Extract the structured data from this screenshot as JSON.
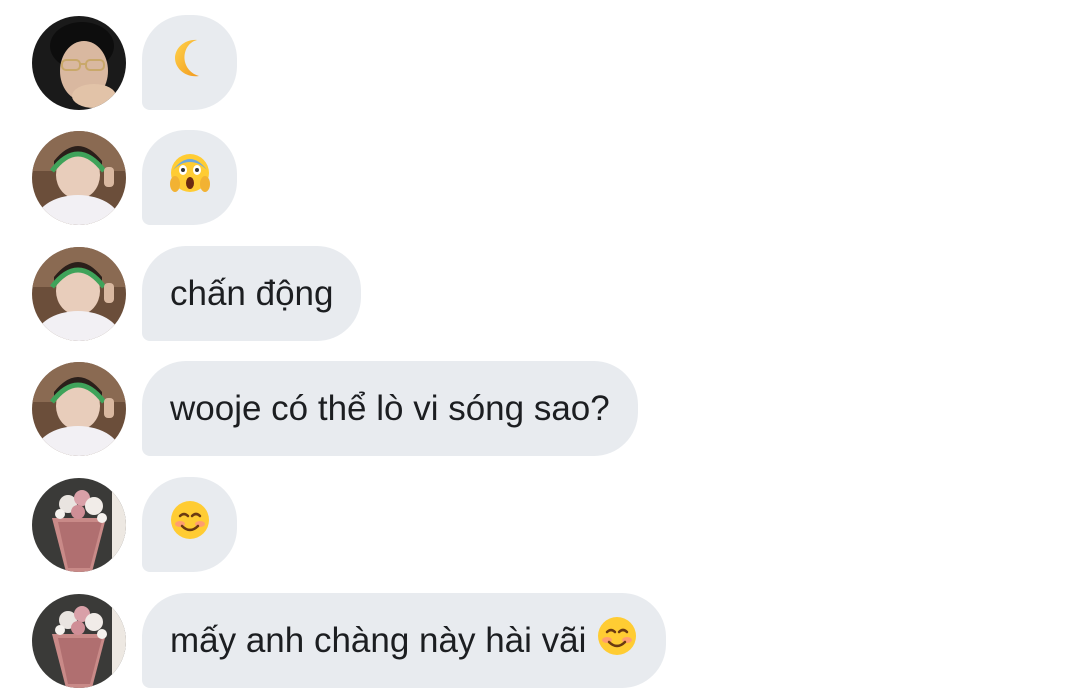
{
  "messages": [
    {
      "avatar": "glasses-man-avatar",
      "text": "",
      "emoji": "crescent-moon-icon"
    },
    {
      "avatar": "headphones-boy-avatar",
      "text": "",
      "emoji": "screaming-face-icon"
    },
    {
      "avatar": "headphones-boy-avatar",
      "text": "chấn động",
      "emoji": ""
    },
    {
      "avatar": "headphones-boy-avatar",
      "text": "wooje có thể lò vi sóng sao?",
      "emoji": ""
    },
    {
      "avatar": "flower-bouquet-avatar",
      "text": "",
      "emoji": "smiling-face-icon"
    },
    {
      "avatar": "flower-bouquet-avatar",
      "text": "mấy anh chàng này hài vãi",
      "emoji": "smiling-face-icon"
    }
  ],
  "colors": {
    "bubble": "#e8ebef",
    "text": "#1c1e21",
    "background": "#ffffff"
  }
}
